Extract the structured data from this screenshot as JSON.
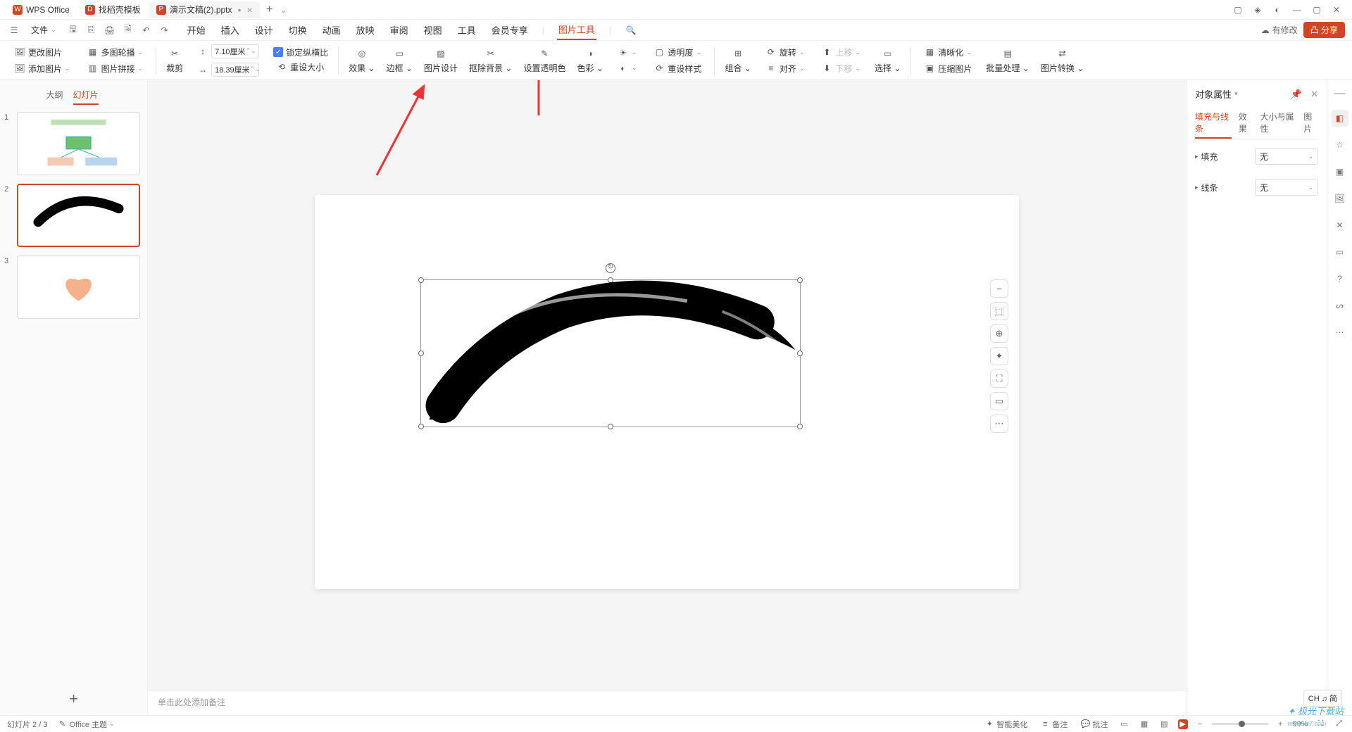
{
  "titlebar": {
    "app_tab": "WPS Office",
    "template_tab": "找稻壳模板",
    "file_tab": "演示文稿(2).pptx",
    "dirty_marker": "•"
  },
  "menubar": {
    "file": "文件",
    "tabs": [
      "开始",
      "插入",
      "设计",
      "切换",
      "动画",
      "放映",
      "审阅",
      "视图",
      "工具",
      "会员专享",
      "图片工具"
    ],
    "active_index": 10,
    "modify_label": "有修改",
    "share_label": "分享"
  },
  "ribbon": {
    "change_image": "更改图片",
    "multi_round": "多图轮播",
    "add_image": "添加图片",
    "image_join": "图片拼接",
    "crop": "裁剪",
    "width_val": "7.10厘米",
    "height_val": "18.39厘米",
    "lock_aspect": "锁定纵横比",
    "reset_size": "重设大小",
    "effects": "效果",
    "border": "边框",
    "image_design": "图片设计",
    "remove_bg": "抠除背景",
    "set_trans_color": "设置透明色",
    "color": "色彩",
    "transparency": "透明度",
    "reset_style": "重设样式",
    "group": "组合",
    "rotate": "旋转",
    "align": "对齐",
    "move_up": "上移",
    "move_down": "下移",
    "select": "选择",
    "enhance": "清晰化",
    "compress": "压缩图片",
    "batch": "批量处理",
    "convert": "图片转换"
  },
  "slidebar": {
    "outline": "大纲",
    "slides": "幻灯片",
    "nums": [
      "1",
      "2",
      "3"
    ]
  },
  "float_tools": [
    "−",
    "⿴",
    "⊕",
    "✦",
    "⛶",
    "▭",
    "⋯"
  ],
  "notes_placeholder": "单击此处添加备注",
  "rpanel": {
    "title": "对象属性",
    "tabs": [
      "填充与线条",
      "效果",
      "大小与属性",
      "图片"
    ],
    "active_tab": 0,
    "fill_label": "填充",
    "line_label": "线条",
    "none": "无"
  },
  "statusbar": {
    "slide_of": "幻灯片 2 / 3",
    "theme": "Office 主题",
    "smart_beauty": "智能美化",
    "notes": "备注",
    "comments": "批注",
    "zoom": "99%"
  },
  "ime": "CH ♫ 简",
  "watermark": {
    "main": "极光下载站",
    "sub": "www.xz7.com"
  }
}
